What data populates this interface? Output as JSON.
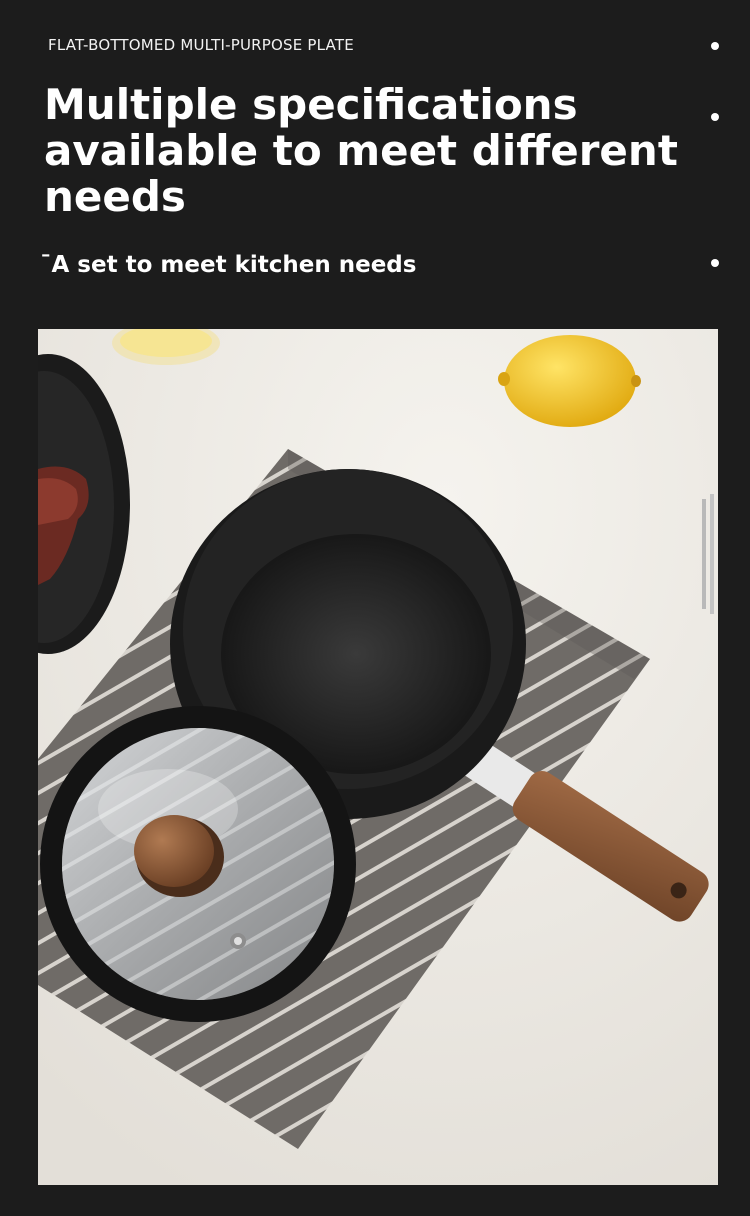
{
  "header": {
    "kicker": "FLAT-BOTTOMED MULTI-PURPOSE PLATE",
    "headline": "Multiple specifications available to meet different needs",
    "subline": "¯A set to meet kitchen needs"
  },
  "photo": {
    "subject": "saucepan-with-glass-lid",
    "colors": {
      "background": "#1c1c1c",
      "table": "#ece9e3",
      "pan": "#1f1f1f",
      "wood": "#8a5a3b",
      "lemon": "#f2c21b",
      "napkin": "#6e6a66"
    }
  }
}
